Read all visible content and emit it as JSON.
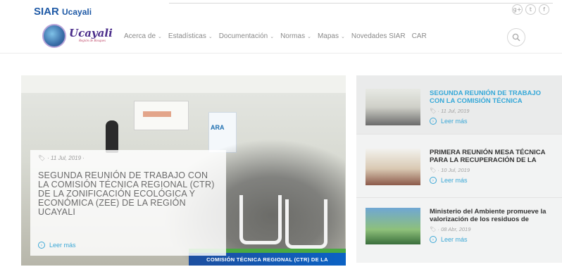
{
  "brand": {
    "name": "SIAR",
    "region": "Ucayali"
  },
  "social": [
    {
      "icon": "google-plus-icon",
      "glyph": "g+"
    },
    {
      "icon": "twitter-icon",
      "glyph": "t"
    },
    {
      "icon": "facebook-icon",
      "glyph": "f"
    }
  ],
  "logo": {
    "word": "Ucayali",
    "tagline": "Región de Bosques"
  },
  "nav": {
    "items": [
      {
        "label": "Acerca de",
        "has_dropdown": true
      },
      {
        "label": "Estadísticas",
        "has_dropdown": true
      },
      {
        "label": "Documentación",
        "has_dropdown": true
      },
      {
        "label": "Normas",
        "has_dropdown": true
      },
      {
        "label": "Mapas",
        "has_dropdown": true
      },
      {
        "label": "Novedades SIAR",
        "has_dropdown": false
      },
      {
        "label": "CAR",
        "has_dropdown": false
      }
    ],
    "search_icon": "search-icon"
  },
  "featured": {
    "date": "11 Jul, 2019",
    "title": "SEGUNDA REUNIÓN DE TRABAJO CON LA COMISIÓN TÉCNICA REGIONAL (CTR) DE LA ZONIFICACIÓN ECOLÓGICA Y ECONÓMICA (ZEE) DE LA REGIÓN UCAYALI",
    "read_more": "Leer más",
    "image_stripe": "COMISIÓN TÉCNICA REGIONAL (CTR) DE LA",
    "screen_text": "",
    "banner_text": "ARA"
  },
  "side_posts": [
    {
      "title": "SEGUNDA REUNIÓN DE TRABAJO CON LA COMISIÓN TÉCNICA",
      "date": "11 Jul, 2019",
      "read_more": "Leer más",
      "active": true
    },
    {
      "title": "PRIMERA REUNIÓN MESA TÉCNICA PARA LA RECUPERACIÓN DE LA",
      "date": "10 Jul, 2019",
      "read_more": "Leer más",
      "active": false
    },
    {
      "title": "Ministerio del Ambiente promueve la valorización de los residuos de",
      "date": "08 Abr, 2019",
      "read_more": "Leer más",
      "active": false
    }
  ],
  "colors": {
    "brand_blue": "#1f5aa6",
    "accent": "#35a8d8",
    "nav_text": "#8a8a8a"
  }
}
